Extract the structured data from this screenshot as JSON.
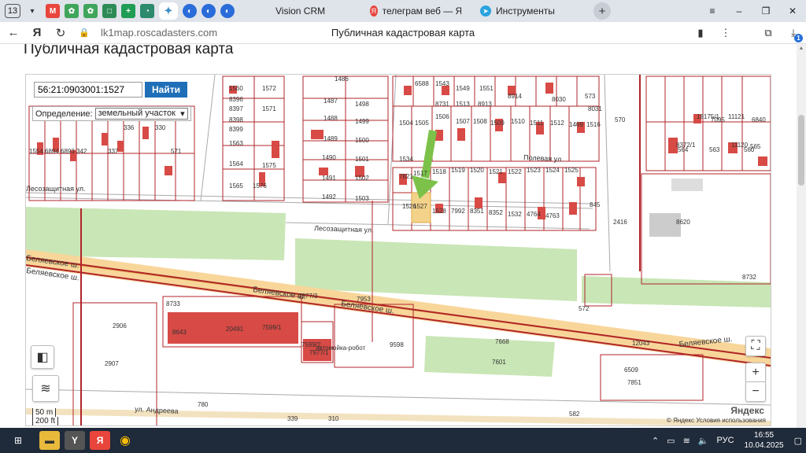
{
  "browser": {
    "tab_count": "13",
    "tabs": [
      {
        "label": "Vision CRM",
        "icon": "vision-crm-favicon"
      },
      {
        "label": "телеграм веб — Яндекс: н",
        "icon": "yandex-favicon"
      },
      {
        "label": "Инструменты",
        "icon": "telegram-favicon"
      }
    ],
    "url": "lk1map.roscadasters.com",
    "page_title": "Публичная кадастровая карта",
    "download_badge": "1"
  },
  "page": {
    "heading": "Публичная кадастровая карта"
  },
  "map": {
    "search_value": "56:21:0903001:1527",
    "find_label": "Найти",
    "definition_label": "Определение:",
    "definition_value": "земельный участок",
    "scale_50": "50 m",
    "scale_200": "200 ft",
    "copyright": "© Яндекс  Условия использования",
    "logo": "Яндекс",
    "zoom_in": "+",
    "zoom_out": "−",
    "streets": {
      "lesozashchitnaya_1": "Лесозащитная ул.",
      "lesozashchitnaya_2": "Лесозащитная ул.",
      "belyaevskoe_1": "Беляевское ш.",
      "belyaevskoe_2": "Беляевское ш.",
      "belyaevskoe_3": "Беляевское ш.",
      "belyaevskoe_4": "Беляевское ш.",
      "belyaevskoe_5": "Беляевское ш.",
      "andreeva": "ул. Андреева",
      "polevaya": "Полевая ул."
    },
    "parcels": [
      "1560",
      "8396",
      "8397",
      "8398",
      "8399",
      "1563",
      "1564",
      "1565",
      "1572",
      "1575",
      "1576",
      "1571",
      "1486",
      "1487",
      "1498",
      "1488",
      "1499",
      "1489",
      "1500",
      "1490",
      "1501",
      "1491",
      "1502",
      "1492",
      "1503",
      "1504",
      "1505",
      "1506",
      "1507",
      "1508",
      "1509",
      "1510",
      "1511",
      "1512",
      "1469",
      "1516",
      "1517",
      "1518",
      "1519",
      "1520",
      "1521",
      "1522",
      "1523",
      "1524",
      "1525",
      "1526",
      "1527",
      "1528",
      "7992",
      "8351",
      "8352",
      "1532",
      "4764",
      "4763",
      "1534",
      "7821",
      "845",
      "2416",
      "8620",
      "8732",
      "7953",
      "8733",
      "8643",
      "20491",
      "7599/1",
      "7599/2",
      "7977/1",
      "7977/3",
      "9598",
      "7601",
      "7668",
      "6509",
      "12043",
      "7851",
      "780",
      "582",
      "339",
      "310",
      "2906",
      "2907",
      "8372/1",
      "18175/1",
      "11121",
      "11120",
      "6840",
      "565",
      "570",
      "572",
      "573",
      "8031",
      "8030",
      "6588",
      "1543",
      "1549",
      "1551",
      "1554",
      "6894",
      "6893",
      "342",
      "337",
      "336",
      "330",
      "571",
      "564",
      "563",
      "560",
      "7095",
      "8914",
      "8913",
      "1513",
      "8731"
    ],
    "poi": "автомойка-робот"
  },
  "taskbar": {
    "lang": "РУС",
    "time": "16:55",
    "date": "10.04.2025"
  },
  "colors": {
    "parcel_border": "#b0252a",
    "building": "#d84a45",
    "green_zone": "#c9e6b6",
    "highway": "#f5c26b",
    "selected_parcel": "#f3d38a",
    "arrow": "#7cc24a",
    "find_button": "#1f6fb8"
  }
}
